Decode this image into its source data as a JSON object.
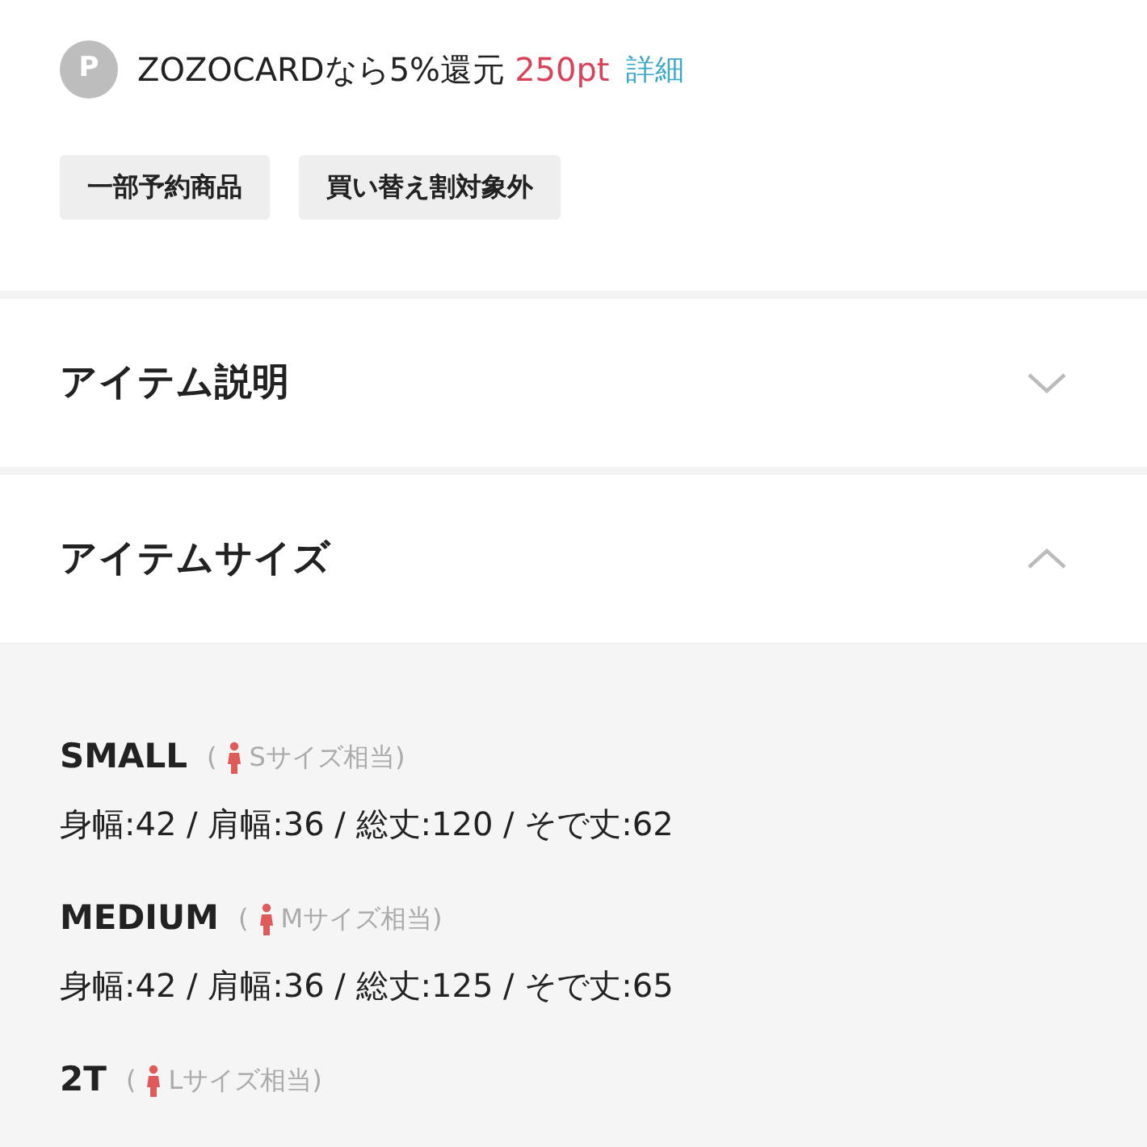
{
  "points": {
    "badge": "P",
    "text": "ZOZOCARDなら5%還元",
    "amount": "250pt",
    "link": "詳細"
  },
  "tags": [
    "一部予約商品",
    "買い替え割対象外"
  ],
  "sections": [
    {
      "title": "アイテム説明",
      "expanded": false
    },
    {
      "title": "アイテムサイズ",
      "expanded": true
    }
  ],
  "sizes": [
    {
      "name": "SMALL",
      "open": "(",
      "equivalent": "Sサイズ相当)",
      "measurements": "身幅:42 / 肩幅:36 / 総丈:120 / そで丈:62"
    },
    {
      "name": "MEDIUM",
      "open": "(",
      "equivalent": "Mサイズ相当)",
      "measurements": "身幅:42 / 肩幅:36 / 総丈:125 / そで丈:65"
    },
    {
      "name": "2T",
      "open": "(",
      "equivalent": "Lサイズ相当)"
    }
  ]
}
